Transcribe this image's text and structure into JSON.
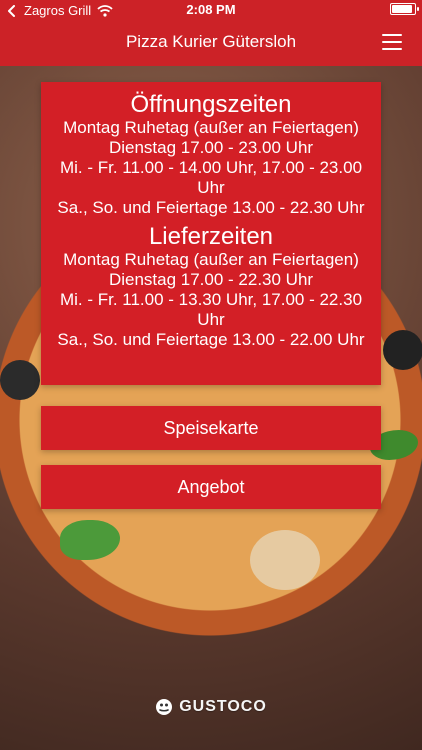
{
  "status": {
    "back_label": "Zagros Grill",
    "time": "2:08 PM"
  },
  "nav": {
    "title": "Pizza Kurier Gütersloh",
    "icons": {
      "menu": "hamburger-menu-icon"
    }
  },
  "opening": {
    "title": "Öffnungszeiten",
    "lines": [
      "Montag Ruhetag (außer an Feiertagen)",
      "Dienstag 17.00 - 23.00 Uhr",
      "Mi. - Fr. 11.00 - 14.00 Uhr, 17.00 - 23.00 Uhr",
      "Sa., So. und Feiertage 13.00 - 22.30 Uhr"
    ]
  },
  "delivery": {
    "title": "Lieferzeiten",
    "lines": [
      "Montag Ruhetag (außer an Feiertagen)",
      "Dienstag 17.00 - 22.30 Uhr",
      "Mi. - Fr. 11.00 - 13.30 Uhr, 17.00 - 22.30 Uhr",
      "Sa., So. und Feiertage 13.00 - 22.00 Uhr"
    ]
  },
  "buttons": {
    "menu": "Speisekarte",
    "offer": "Angebot"
  },
  "brand": {
    "name": "GUSTOCO"
  },
  "colors": {
    "accent": "#d31f26",
    "bar": "#cc2227",
    "text": "#ffffff"
  }
}
